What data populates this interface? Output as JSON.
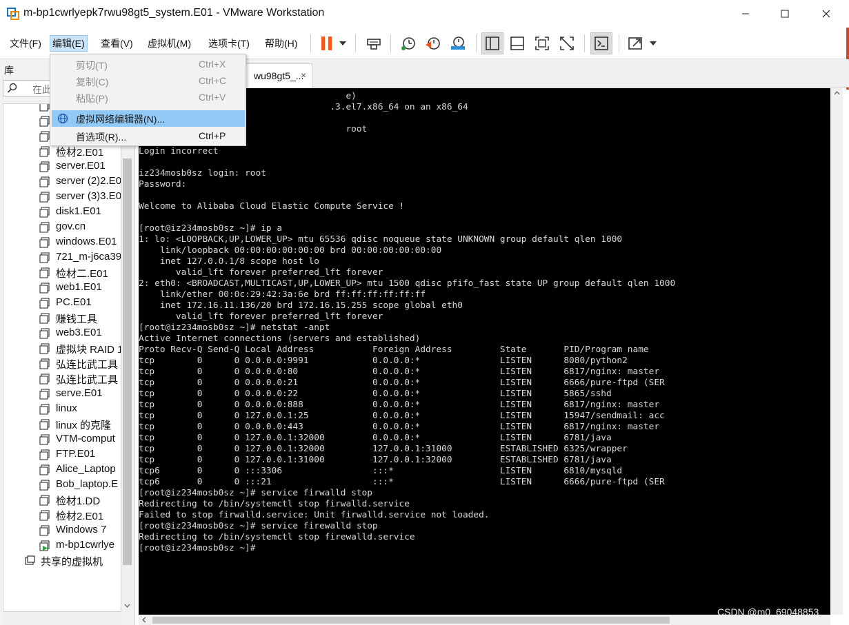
{
  "window": {
    "title": "m-bp1cwrlyepk7rwu98gt5_system.E01 - VMware Workstation",
    "controls": [
      "minimize",
      "maximize",
      "close"
    ]
  },
  "menubar": {
    "items": [
      {
        "label": "文件(F)"
      },
      {
        "label": "编辑(E)"
      },
      {
        "label": "查看(V)"
      },
      {
        "label": "虚拟机(M)"
      },
      {
        "label": "选项卡(T)"
      },
      {
        "label": "帮助(H)"
      }
    ]
  },
  "toolbar": {
    "icons": [
      "pause-icon",
      "dropdown-arrow-icon",
      "send-ctrl-alt-del-icon",
      "snapshot-icon",
      "revert-snapshot-icon",
      "snapshot-manager-icon",
      "library-view-icon",
      "thumbnail-view-icon",
      "fullscreen-icon",
      "unity-icon",
      "console-view-icon",
      "stretch-guest-icon"
    ]
  },
  "edit_menu": {
    "items": [
      {
        "label": "剪切(T)",
        "shortcut": "Ctrl+X",
        "enabled": false
      },
      {
        "label": "复制(C)",
        "shortcut": "Ctrl+C",
        "enabled": false
      },
      {
        "label": "粘贴(P)",
        "shortcut": "Ctrl+V",
        "enabled": false
      },
      {
        "label": "虚拟网络编辑器(N)...",
        "shortcut": "",
        "enabled": true
      },
      {
        "label": "首选项(R)...",
        "shortcut": "Ctrl+P",
        "enabled": true
      }
    ]
  },
  "library": {
    "title": "库",
    "search_placeholder": "在此",
    "items": [
      {
        "label": "CentOS 7 64"
      },
      {
        "label": "2003"
      },
      {
        "label": "检材1.DD"
      },
      {
        "label": "检材2.E01"
      },
      {
        "label": "server.E01"
      },
      {
        "label": "server (2)2.E0"
      },
      {
        "label": "server (3)3.E0"
      },
      {
        "label": "disk1.E01"
      },
      {
        "label": "gov.cn"
      },
      {
        "label": "windows.E01"
      },
      {
        "label": "721_m-j6ca39"
      },
      {
        "label": "检材二.E01"
      },
      {
        "label": "web1.E01"
      },
      {
        "label": "PC.E01"
      },
      {
        "label": "赚钱工具"
      },
      {
        "label": "web3.E01"
      },
      {
        "label": "虚拟块 RAID 1"
      },
      {
        "label": "弘连比武工具"
      },
      {
        "label": "弘连比武工具"
      },
      {
        "label": "serve.E01"
      },
      {
        "label": "linux"
      },
      {
        "label": "linux 的克隆"
      },
      {
        "label": "VTM-comput"
      },
      {
        "label": "FTP.E01"
      },
      {
        "label": "Alice_Laptop"
      },
      {
        "label": "Bob_laptop.E"
      },
      {
        "label": "检材1.DD"
      },
      {
        "label": "检材2.E01"
      },
      {
        "label": "Windows 7"
      },
      {
        "label": "m-bp1cwrlye"
      },
      {
        "label": "共享的虚拟机"
      }
    ]
  },
  "tab": {
    "label": "wu98gt5_...",
    "close": "×"
  },
  "console": {
    "lines": [
      "                                       e)",
      "                                    .3.el7.x86_64 on an x86_64",
      "",
      "                                       root",
      "Password:",
      "Login incorrect",
      "",
      "iz234mosb0sz login: root",
      "Password:",
      "",
      "Welcome to Alibaba Cloud Elastic Compute Service !",
      "",
      "[root@iz234mosb0sz ~]# ip a",
      "1: lo: <LOOPBACK,UP,LOWER_UP> mtu 65536 qdisc noqueue state UNKNOWN group default qlen 1000",
      "    link/loopback 00:00:00:00:00:00 brd 00:00:00:00:00:00",
      "    inet 127.0.0.1/8 scope host lo",
      "       valid_lft forever preferred_lft forever",
      "2: eth0: <BROADCAST,MULTICAST,UP,LOWER_UP> mtu 1500 qdisc pfifo_fast state UP group default qlen 1000",
      "    link/ether 00:0c:29:42:3a:6e brd ff:ff:ff:ff:ff:ff",
      "    inet 172.16.11.136/20 brd 172.16.15.255 scope global eth0",
      "       valid_lft forever preferred_lft forever",
      "[root@iz234mosb0sz ~]# netstat -anpt",
      "Active Internet connections (servers and established)",
      "Proto Recv-Q Send-Q Local Address           Foreign Address         State       PID/Program name",
      "tcp        0      0 0.0.0.0:9991            0.0.0.0:*               LISTEN      8080/python2",
      "tcp        0      0 0.0.0.0:80              0.0.0.0:*               LISTEN      6817/nginx: master",
      "tcp        0      0 0.0.0.0:21              0.0.0.0:*               LISTEN      6666/pure-ftpd (SER",
      "tcp        0      0 0.0.0.0:22              0.0.0.0:*               LISTEN      5865/sshd",
      "tcp        0      0 0.0.0.0:888             0.0.0.0:*               LISTEN      6817/nginx: master",
      "tcp        0      0 127.0.0.1:25            0.0.0.0:*               LISTEN      15947/sendmail: acc",
      "tcp        0      0 0.0.0.0:443             0.0.0.0:*               LISTEN      6817/nginx: master",
      "tcp        0      0 127.0.0.1:32000         0.0.0.0:*               LISTEN      6781/java",
      "tcp        0      0 127.0.0.1:32000         127.0.0.1:31000         ESTABLISHED 6325/wrapper",
      "tcp        0      0 127.0.0.1:31000         127.0.0.1:32000         ESTABLISHED 6781/java",
      "tcp6       0      0 :::3306                 :::*                    LISTEN      6810/mysqld",
      "tcp6       0      0 :::21                   :::*                    LISTEN      6666/pure-ftpd (SER",
      "[root@iz234mosb0sz ~]# service firwalld stop",
      "Redirecting to /bin/systemctl stop firwalld.service",
      "Failed to stop firwalld.service: Unit firwalld.service not loaded.",
      "[root@iz234mosb0sz ~]# service firewalld stop",
      "Redirecting to /bin/systemctl stop firewalld.service",
      "[root@iz234mosb0sz ~]#"
    ]
  },
  "watermark": "CSDN @m0_69048853"
}
